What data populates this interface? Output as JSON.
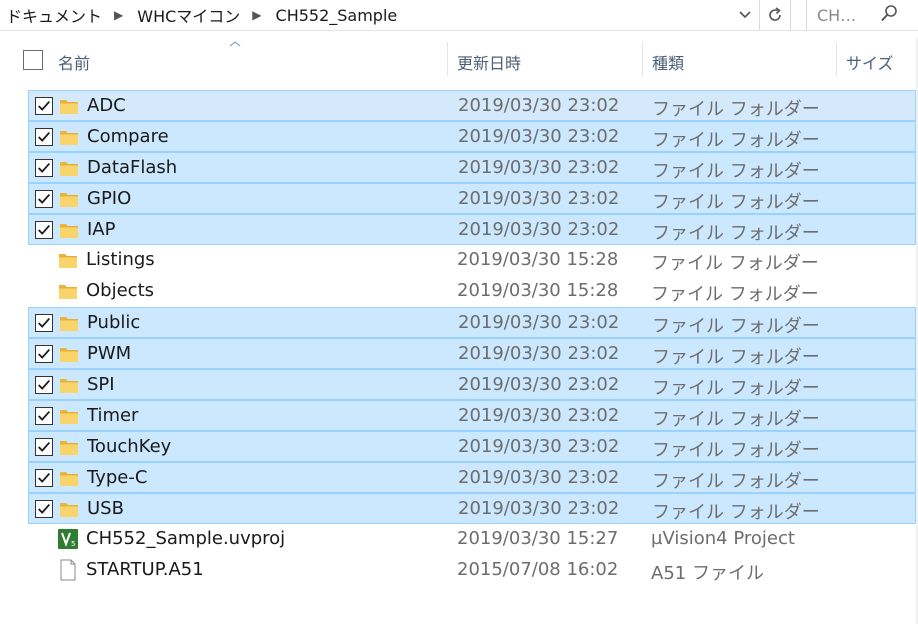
{
  "breadcrumb": {
    "items": [
      "ドキュメント",
      "WHCマイコン",
      "CH552_Sample"
    ],
    "separator": "▶"
  },
  "search": {
    "placeholder": "CH…"
  },
  "columns": {
    "name": "名前",
    "modified": "更新日時",
    "type": "種類",
    "size": "サイズ"
  },
  "files": [
    {
      "name": "ADC",
      "modified": "2019/03/30 23:02",
      "type": "ファイル フォルダー",
      "icon": "folder-icon",
      "selected": true
    },
    {
      "name": "Compare",
      "modified": "2019/03/30 23:02",
      "type": "ファイル フォルダー",
      "icon": "folder-icon",
      "selected": true
    },
    {
      "name": "DataFlash",
      "modified": "2019/03/30 23:02",
      "type": "ファイル フォルダー",
      "icon": "folder-icon",
      "selected": true
    },
    {
      "name": "GPIO",
      "modified": "2019/03/30 23:02",
      "type": "ファイル フォルダー",
      "icon": "folder-icon",
      "selected": true
    },
    {
      "name": "IAP",
      "modified": "2019/03/30 23:02",
      "type": "ファイル フォルダー",
      "icon": "folder-icon",
      "selected": true
    },
    {
      "name": "Listings",
      "modified": "2019/03/30 15:28",
      "type": "ファイル フォルダー",
      "icon": "folder-icon",
      "selected": false
    },
    {
      "name": "Objects",
      "modified": "2019/03/30 15:28",
      "type": "ファイル フォルダー",
      "icon": "folder-icon",
      "selected": false
    },
    {
      "name": "Public",
      "modified": "2019/03/30 23:02",
      "type": "ファイル フォルダー",
      "icon": "folder-icon",
      "selected": true
    },
    {
      "name": "PWM",
      "modified": "2019/03/30 23:02",
      "type": "ファイル フォルダー",
      "icon": "folder-icon",
      "selected": true
    },
    {
      "name": "SPI",
      "modified": "2019/03/30 23:02",
      "type": "ファイル フォルダー",
      "icon": "folder-icon",
      "selected": true
    },
    {
      "name": "Timer",
      "modified": "2019/03/30 23:02",
      "type": "ファイル フォルダー",
      "icon": "folder-icon",
      "selected": true
    },
    {
      "name": "TouchKey",
      "modified": "2019/03/30 23:02",
      "type": "ファイル フォルダー",
      "icon": "folder-icon",
      "selected": true
    },
    {
      "name": "Type-C",
      "modified": "2019/03/30 23:02",
      "type": "ファイル フォルダー",
      "icon": "folder-icon",
      "selected": true
    },
    {
      "name": "USB",
      "modified": "2019/03/30 23:02",
      "type": "ファイル フォルダー",
      "icon": "folder-icon",
      "selected": true
    },
    {
      "name": "CH552_Sample.uvproj",
      "modified": "2019/03/30 15:27",
      "type": "µVision4 Project",
      "icon": "uvision-project-icon",
      "selected": false
    },
    {
      "name": "STARTUP.A51",
      "modified": "2015/07/08 16:02",
      "type": "A51 ファイル",
      "icon": "document-icon",
      "selected": false
    }
  ],
  "colors": {
    "selection_bg": "#cce8ff",
    "selection_border": "#99d1ff",
    "header_text": "#4c607a",
    "detail_text": "#6d6d6d",
    "folder_yellow": "#f5c342"
  }
}
